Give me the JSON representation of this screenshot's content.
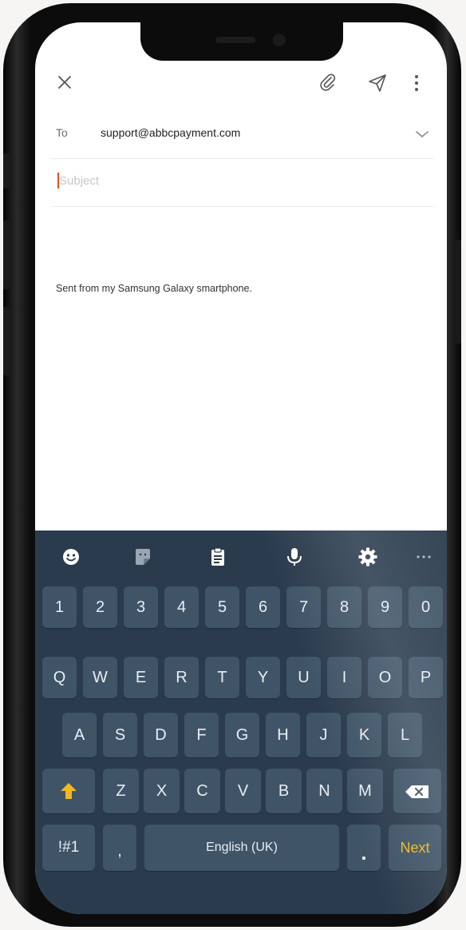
{
  "compose": {
    "to_label": "To",
    "to_value": "support@abbcpayment.com",
    "subject_placeholder": "Subject",
    "subject_value": "",
    "signature": "Sent from my Samsung Galaxy smartphone."
  },
  "toolbar_icons": [
    "close-icon",
    "attach-icon",
    "send-icon",
    "more-vertical-icon",
    "chevron-down-icon"
  ],
  "keyboard": {
    "toolbar": [
      "emoji-icon",
      "sticker-icon",
      "clipboard-icon",
      "microphone-icon",
      "gear-icon",
      "more-horizontal-icon"
    ],
    "row_numbers": [
      "1",
      "2",
      "3",
      "4",
      "5",
      "6",
      "7",
      "8",
      "9",
      "0"
    ],
    "row_top": [
      "Q",
      "W",
      "E",
      "R",
      "T",
      "Y",
      "U",
      "I",
      "O",
      "P"
    ],
    "row_middle": [
      "A",
      "S",
      "D",
      "F",
      "G",
      "H",
      "J",
      "K",
      "L"
    ],
    "row_bottom": [
      "Z",
      "X",
      "C",
      "V",
      "B",
      "N",
      "M"
    ],
    "symbols_key": "!#1",
    "comma_key": ",",
    "space_key": "English (UK)",
    "period_key": ".",
    "next_key": "Next"
  },
  "colors": {
    "keyboard_bg": "#2a3b4d",
    "key_bg": "#3f5467",
    "accent_yellow": "#f2b91e",
    "caret": "#d9541e"
  }
}
